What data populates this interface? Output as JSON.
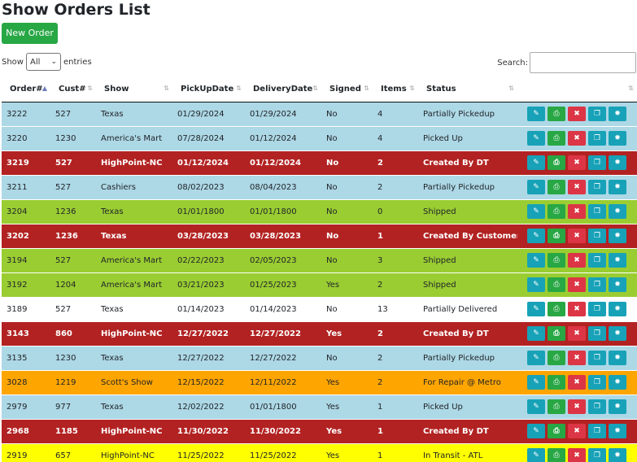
{
  "page": {
    "title": "Show Orders List"
  },
  "toolbar": {
    "new_order_label": "New Order"
  },
  "length": {
    "prefix": "Show",
    "selected": "All",
    "suffix": "entries"
  },
  "search": {
    "label": "Search:",
    "value": ""
  },
  "colors": {
    "light_blue": "#add8e6",
    "red": "#b22222",
    "green": "#9acd32",
    "white": "#ffffff",
    "orange": "#ffa500",
    "yellow": "#ffff00"
  },
  "table": {
    "columns": [
      "Order#",
      "Cust#",
      "Show",
      "PickUpDate",
      "DeliveryDate",
      "Signed",
      "Items",
      "Status",
      ""
    ],
    "rows": [
      {
        "order": "3222",
        "cust": "527",
        "show": "Texas",
        "pickup": "01/29/2024",
        "delivery": "01/29/2024",
        "signed": "No",
        "items": "4",
        "status": "Partially Pickedup",
        "color": "#add8e6",
        "text": "#212529",
        "bold": false
      },
      {
        "order": "3220",
        "cust": "1230",
        "show": "America's Mart",
        "pickup": "07/28/2024",
        "delivery": "01/12/2024",
        "signed": "No",
        "items": "4",
        "status": "Picked Up",
        "color": "#add8e6",
        "text": "#212529",
        "bold": false
      },
      {
        "order": "3219",
        "cust": "527",
        "show": "HighPoint-NC",
        "pickup": "01/12/2024",
        "delivery": "01/12/2024",
        "signed": "No",
        "items": "2",
        "status": "Created By DT",
        "color": "#b22222",
        "text": "#ffffff",
        "bold": true
      },
      {
        "order": "3211",
        "cust": "527",
        "show": "Cashiers",
        "pickup": "08/02/2023",
        "delivery": "08/04/2023",
        "signed": "No",
        "items": "2",
        "status": "Partially Pickedup",
        "color": "#add8e6",
        "text": "#212529",
        "bold": false
      },
      {
        "order": "3204",
        "cust": "1236",
        "show": "Texas",
        "pickup": "01/01/1800",
        "delivery": "01/01/1800",
        "signed": "No",
        "items": "0",
        "status": "Shipped",
        "color": "#9acd32",
        "text": "#212529",
        "bold": false
      },
      {
        "order": "3202",
        "cust": "1236",
        "show": "Texas",
        "pickup": "03/28/2023",
        "delivery": "03/28/2023",
        "signed": "No",
        "items": "1",
        "status": "Created By Customer",
        "color": "#b22222",
        "text": "#ffffff",
        "bold": true
      },
      {
        "order": "3194",
        "cust": "527",
        "show": "America's Mart",
        "pickup": "02/22/2023",
        "delivery": "02/05/2023",
        "signed": "No",
        "items": "3",
        "status": "Shipped",
        "color": "#9acd32",
        "text": "#212529",
        "bold": false
      },
      {
        "order": "3192",
        "cust": "1204",
        "show": "America's Mart",
        "pickup": "03/21/2023",
        "delivery": "01/25/2023",
        "signed": "Yes",
        "items": "2",
        "status": "Shipped",
        "color": "#9acd32",
        "text": "#212529",
        "bold": false
      },
      {
        "order": "3189",
        "cust": "527",
        "show": "Texas",
        "pickup": "01/14/2023",
        "delivery": "01/14/2023",
        "signed": "No",
        "items": "13",
        "status": "Partially Delivered",
        "color": "#ffffff",
        "text": "#212529",
        "bold": false
      },
      {
        "order": "3143",
        "cust": "860",
        "show": "HighPoint-NC",
        "pickup": "12/27/2022",
        "delivery": "12/27/2022",
        "signed": "Yes",
        "items": "2",
        "status": "Created By DT",
        "color": "#b22222",
        "text": "#ffffff",
        "bold": true
      },
      {
        "order": "3135",
        "cust": "1230",
        "show": "Texas",
        "pickup": "12/27/2022",
        "delivery": "12/27/2022",
        "signed": "No",
        "items": "2",
        "status": "Partially Pickedup",
        "color": "#add8e6",
        "text": "#212529",
        "bold": false
      },
      {
        "order": "3028",
        "cust": "1219",
        "show": "Scott's Show",
        "pickup": "12/15/2022",
        "delivery": "12/11/2022",
        "signed": "Yes",
        "items": "2",
        "status": "For Repair @ Metro",
        "color": "#ffa500",
        "text": "#212529",
        "bold": false
      },
      {
        "order": "2979",
        "cust": "977",
        "show": "Texas",
        "pickup": "12/02/2022",
        "delivery": "01/01/1800",
        "signed": "Yes",
        "items": "1",
        "status": "Picked Up",
        "color": "#add8e6",
        "text": "#212529",
        "bold": false
      },
      {
        "order": "2968",
        "cust": "1185",
        "show": "HighPoint-NC",
        "pickup": "11/30/2022",
        "delivery": "11/30/2022",
        "signed": "Yes",
        "items": "1",
        "status": "Created By DT",
        "color": "#b22222",
        "text": "#ffffff",
        "bold": true
      },
      {
        "order": "2919",
        "cust": "657",
        "show": "HighPoint-NC",
        "pickup": "11/25/2022",
        "delivery": "11/25/2022",
        "signed": "Yes",
        "items": "1",
        "status": "In Transit - ATL",
        "color": "#ffff00",
        "text": "#212529",
        "bold": false
      }
    ]
  },
  "icons": {
    "sort_both": "⇅",
    "sort_asc": "▲",
    "chevron": "⌄",
    "edit": "✎",
    "print": "⎙",
    "delete": "✖",
    "copy": "❐",
    "gear": "✹"
  }
}
